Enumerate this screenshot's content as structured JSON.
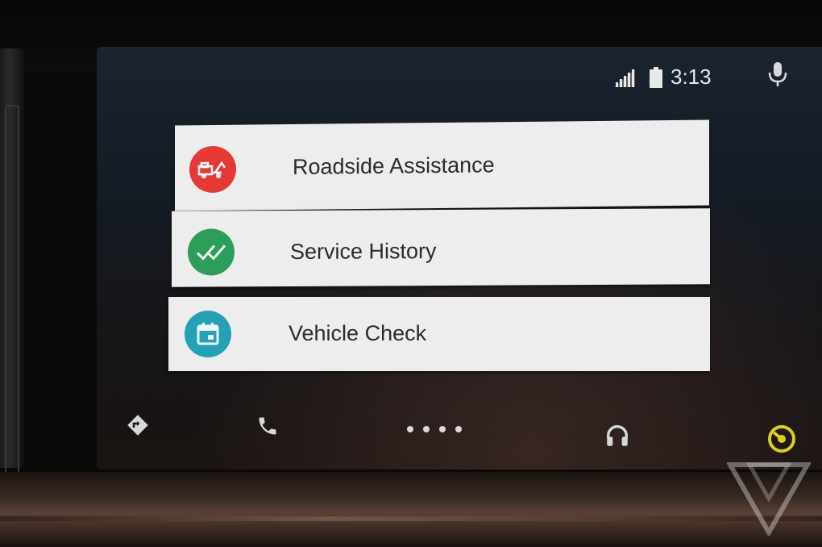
{
  "status_bar": {
    "time": "3:13",
    "icons": [
      "signal-icon",
      "battery-icon",
      "mic-icon"
    ]
  },
  "menu": {
    "items": [
      {
        "label": "Roadside Assistance",
        "icon": "tow-truck-icon",
        "color": "#e53935"
      },
      {
        "label": "Service History",
        "icon": "double-check-icon",
        "color": "#2e9d5c"
      },
      {
        "label": "Vehicle Check",
        "icon": "calendar-icon",
        "color": "#26a0b4"
      }
    ]
  },
  "nav": {
    "items": [
      "navigation-icon",
      "phone-icon",
      "home-dots",
      "headphones-icon",
      "app-launcher-icon"
    ],
    "accent": "#d9d21f"
  }
}
